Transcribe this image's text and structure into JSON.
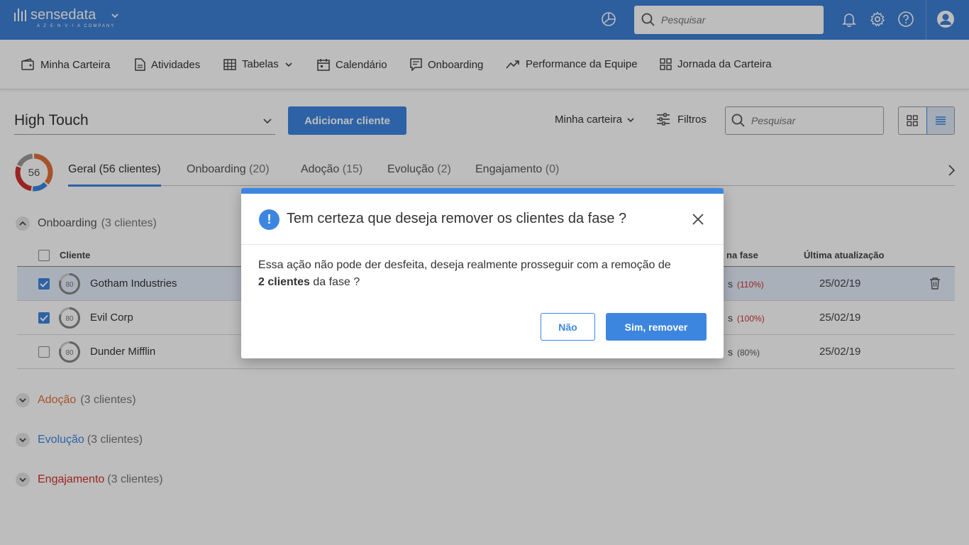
{
  "app": {
    "logo_text": "sensedata",
    "logo_sub": "A Z·E·N·V·I·A COMPANY",
    "search_placeholder": "Pesquisar"
  },
  "nav": {
    "items": [
      {
        "label": "Minha Carteira",
        "icon": "wallet-icon"
      },
      {
        "label": "Atividades",
        "icon": "document-icon"
      },
      {
        "label": "Tabelas",
        "icon": "table-icon"
      },
      {
        "label": "Calendário",
        "icon": "calendar-icon"
      },
      {
        "label": "Onboarding",
        "icon": "onboarding-icon"
      },
      {
        "label": "Performance da Equipe",
        "icon": "trend-icon"
      },
      {
        "label": "Jornada da Carteira",
        "icon": "grid-icon"
      }
    ]
  },
  "toolbar": {
    "portfolio": "High Touch",
    "add_label": "Adicionar cliente",
    "scope_label": "Minha carteira",
    "filters_label": "Filtros",
    "search_placeholder": "Pesquisar"
  },
  "summary": {
    "total": "56"
  },
  "tabs": [
    {
      "label": "Geral",
      "count": "(56 clientes)"
    },
    {
      "label": "Onboarding",
      "count": "(20)"
    },
    {
      "label": "Adoção",
      "count": "(15)"
    },
    {
      "label": "Evolução",
      "count": "(2)"
    },
    {
      "label": "Engajamento",
      "count": "(0)"
    }
  ],
  "groups": [
    {
      "label": "Onboarding",
      "count": "(3 clientes)",
      "color": "#555555"
    },
    {
      "label": "Adoção",
      "count": "(3 clientes)",
      "color": "#e0703a"
    },
    {
      "label": "Evolução",
      "count": "(3 clientes)",
      "color": "#3d86e0"
    },
    {
      "label": "Engajamento",
      "count": "(3 clientes)",
      "color": "#d0312d"
    }
  ],
  "table": {
    "headers": {
      "client": "Cliente",
      "phase": "na fase",
      "updated": "Última atualização"
    },
    "rows": [
      {
        "score": "80",
        "name": "Gotham Industries",
        "phase_suffix": "s",
        "phase_pct": "(110%)",
        "date": "25/02/19",
        "checked": true
      },
      {
        "score": "80",
        "name": "Evil Corp",
        "phase_suffix": "s",
        "phase_pct": "(100%)",
        "date": "25/02/19",
        "checked": true
      },
      {
        "score": "80",
        "name": "Dunder Mifflin",
        "phase_suffix": "s",
        "phase_pct": "(80%)",
        "date": "25/02/19",
        "checked": false
      }
    ]
  },
  "modal": {
    "title": "Tem certeza que deseja remover os clientes da fase ?",
    "body_prefix": "Essa ação não pode der desfeita, deseja realmente prosseguir com a remoção de",
    "body_bold": "2 clientes",
    "body_suffix": " da fase ?",
    "no_label": "Não",
    "yes_label": "Sim, remover"
  },
  "colors": {
    "primary": "#3d86e0",
    "topbar": "#3d7fd6",
    "danger": "#d0312d",
    "adoption": "#e0703a"
  }
}
